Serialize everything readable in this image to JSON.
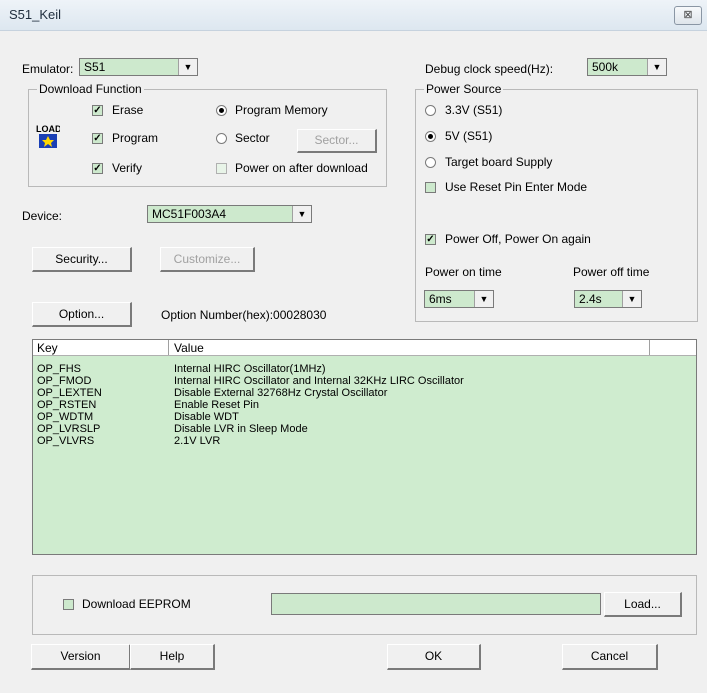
{
  "window": {
    "title": "S51_Keil",
    "close_label": "⊠"
  },
  "emulator": {
    "label": "Emulator:",
    "value": "S51"
  },
  "debug_clock": {
    "label": "Debug clock speed(Hz):",
    "value": "500k"
  },
  "download_function": {
    "title": "Download Function",
    "erase": "Erase",
    "program": "Program",
    "verify": "Verify",
    "program_memory": "Program Memory",
    "sector": "Sector",
    "sector_button": "Sector...",
    "power_after": "Power on after download",
    "icon_text": "LOAD"
  },
  "power_source": {
    "title": "Power Source",
    "opt_33v": "3.3V (S51)",
    "opt_5v": "5V (S51)",
    "opt_target": "Target board Supply",
    "use_reset": "Use Reset Pin Enter Mode",
    "power_off_on": "Power Off, Power On again",
    "power_on_time_label": "Power on time",
    "power_off_time_label": "Power off time",
    "power_on_time": "6ms",
    "power_off_time": "2.4s"
  },
  "device": {
    "label": "Device:",
    "value": "MC51F003A4"
  },
  "buttons": {
    "security": "Security...",
    "customize": "Customize...",
    "option": "Option...",
    "load": "Load...",
    "version": "Version",
    "help": "Help",
    "ok": "OK",
    "cancel": "Cancel"
  },
  "option_number": "Option Number(hex):00028030",
  "table": {
    "headers": [
      "Key",
      "Value"
    ],
    "rows": [
      {
        "key": "OP_FHS",
        "value": "Internal HIRC Oscillator(1MHz)"
      },
      {
        "key": "OP_FMOD",
        "value": "Internal HIRC Oscillator and Internal 32KHz LIRC Oscillator"
      },
      {
        "key": "OP_LEXTEN",
        "value": "Disable External 32768Hz Crystal Oscillator"
      },
      {
        "key": "OP_RSTEN",
        "value": "Enable Reset Pin"
      },
      {
        "key": "OP_WDTM",
        "value": "Disable WDT"
      },
      {
        "key": "OP_LVRSLP",
        "value": "Disable LVR in Sleep Mode"
      },
      {
        "key": "OP_VLVRS",
        "value": "2.1V LVR"
      }
    ]
  },
  "eeprom": {
    "label": "Download EEPROM"
  },
  "colors": {
    "field_green": "#cde9cd",
    "list_green": "#cfeccf"
  }
}
